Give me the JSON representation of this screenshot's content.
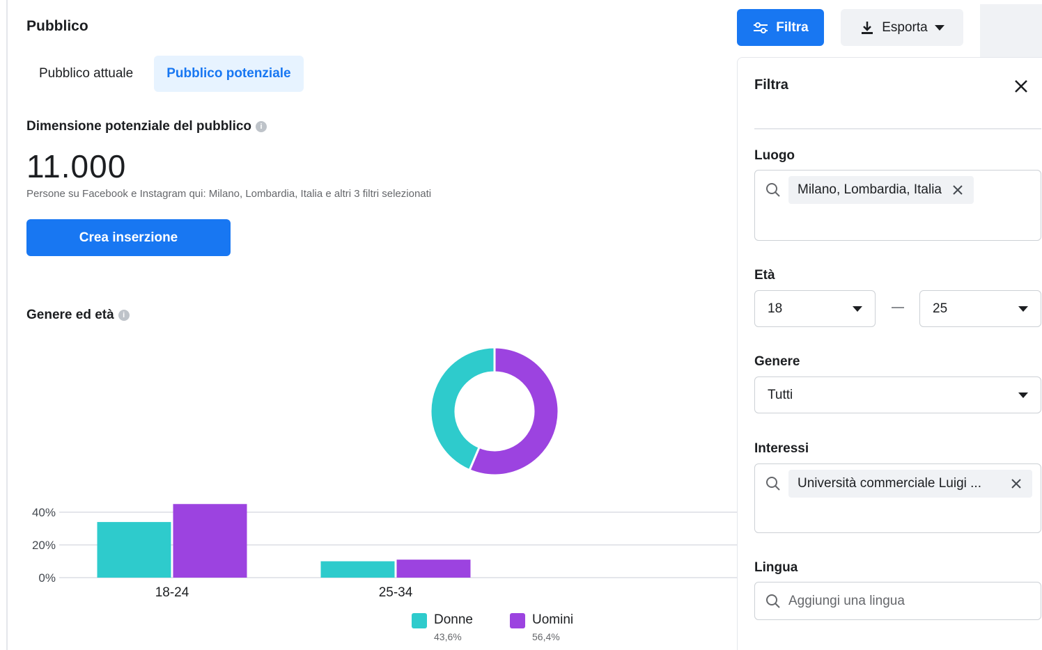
{
  "page": {
    "title": "Pubblico",
    "tabs": [
      "Pubblico attuale",
      "Pubblico potenziale"
    ]
  },
  "audience": {
    "size_label": "Dimensione potenziale del pubblico",
    "size_value": "11.000",
    "note": "Persone su Facebook e Instagram qui: Milano, Lombardia, Italia e altri 3 filtri selezionati",
    "cta": "Crea inserzione"
  },
  "gender_age": {
    "label": "Genere ed età"
  },
  "legend": [
    {
      "name": "Donne",
      "pct": "43,6%",
      "color": "#2ecbcc"
    },
    {
      "name": "Uomini",
      "pct": "56,4%",
      "color": "#9c43e0"
    }
  ],
  "chart_data": [
    {
      "type": "pie",
      "labels": [
        "Donne",
        "Uomini"
      ],
      "values": [
        43.6,
        56.4
      ],
      "colors": [
        "#2ecbcc",
        "#9c43e0"
      ],
      "donut": true
    },
    {
      "type": "bar",
      "categories": [
        "18-24",
        "25-34"
      ],
      "series": [
        {
          "name": "Donne",
          "values": [
            34,
            10
          ],
          "color": "#2ecbcc"
        },
        {
          "name": "Uomini",
          "values": [
            45,
            11
          ],
          "color": "#9c43e0"
        }
      ],
      "yticks": [
        "0%",
        "20%",
        "40%"
      ],
      "ylim": [
        0,
        45
      ],
      "grid": true
    }
  ],
  "toolbar": {
    "filter_label": "Filtra",
    "export_label": "Esporta"
  },
  "filter_panel": {
    "title": "Filtra",
    "location_label": "Luogo",
    "location_chip": "Milano, Lombardia, Italia",
    "age_label": "Età",
    "age_min": "18",
    "age_max": "25",
    "gender_label": "Genere",
    "gender_value": "Tutti",
    "interests_label": "Interessi",
    "interest_chip": "Università commerciale Luigi ...",
    "language_label": "Lingua",
    "language_placeholder": "Aggiungi una lingua"
  }
}
